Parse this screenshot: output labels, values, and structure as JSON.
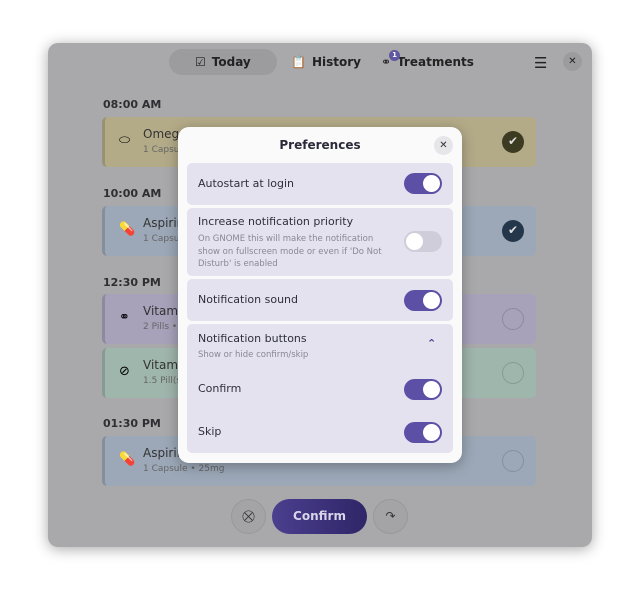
{
  "tabs": [
    {
      "label": "Today",
      "icon": "calendar-check-icon",
      "active": true
    },
    {
      "label": "History",
      "icon": "clipboard-icon"
    },
    {
      "label": "Treatments",
      "icon": "pills-icon",
      "badge": "1"
    }
  ],
  "schedule": [
    {
      "time": "08:00 AM",
      "items": [
        {
          "name": "Omega",
          "sub": "1 Capsul",
          "color": "#b3ab88",
          "icon": "capsule-icon",
          "done": true,
          "check_color": "#3d3a22"
        }
      ]
    },
    {
      "time": "10:00 AM",
      "items": [
        {
          "name": "Aspirin",
          "sub": "1 Capsul",
          "color": "#9ca8b8",
          "icon": "pill-icon",
          "done": true,
          "check_color": "#24374a"
        }
      ]
    },
    {
      "time": "12:30 PM",
      "items": [
        {
          "name": "Vitamin",
          "sub": "2 Pills •",
          "color": "#a7a1ba",
          "icon": "pill-icon",
          "done": false
        },
        {
          "name": "Vitamin",
          "sub": "1.5 Pill(s",
          "color": "#9fb6ad",
          "icon": "tablet-icon",
          "done": false
        }
      ]
    },
    {
      "time": "01:30 PM",
      "items": [
        {
          "name": "Aspirin",
          "sub": "1 Capsule • 25mg",
          "color": "#9ca8b8",
          "icon": "pill-icon",
          "done": false
        }
      ]
    }
  ],
  "bottom": {
    "confirm": "Confirm"
  },
  "prefs": {
    "title": "Preferences",
    "autostart": {
      "label": "Autostart at login",
      "on": true
    },
    "priority": {
      "label": "Increase notification priority",
      "desc": "On GNOME this will make the notification show on fullscreen mode or even if 'Do Not Disturb' is enabled",
      "on": false
    },
    "sound": {
      "label": "Notification sound",
      "on": true
    },
    "buttons": {
      "label": "Notification buttons",
      "desc": "Show or hide confirm/skip",
      "confirm": {
        "label": "Confirm",
        "on": true
      },
      "skip": {
        "label": "Skip",
        "on": true
      }
    }
  },
  "accent": "#5b4fa6"
}
